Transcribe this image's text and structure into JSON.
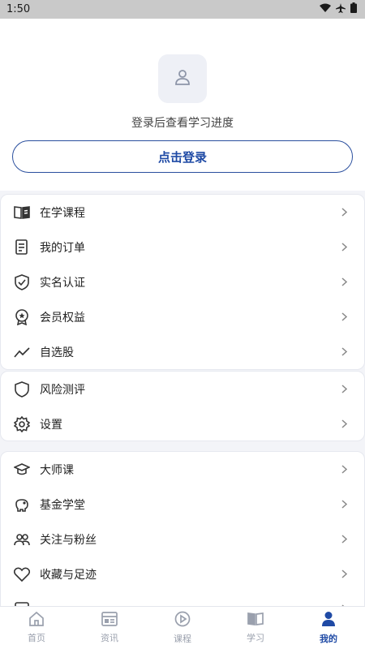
{
  "status_bar": {
    "time": "1:50"
  },
  "profile": {
    "login_hint": "登录后查看学习进度",
    "login_button": "点击登录"
  },
  "menu_group_1": [
    {
      "label": "在学课程",
      "icon": "book-icon"
    },
    {
      "label": "我的订单",
      "icon": "order-icon"
    },
    {
      "label": "实名认证",
      "icon": "shield-check-icon"
    },
    {
      "label": "会员权益",
      "icon": "medal-icon"
    },
    {
      "label": "自选股",
      "icon": "trend-icon"
    }
  ],
  "menu_group_2": [
    {
      "label": "风险测评",
      "icon": "shield-icon"
    },
    {
      "label": "设置",
      "icon": "gear-icon"
    }
  ],
  "menu_group_3": [
    {
      "label": "大师课",
      "icon": "graduation-cap-icon"
    },
    {
      "label": "基金学堂",
      "icon": "piggy-bank-icon"
    },
    {
      "label": "关注与粉丝",
      "icon": "users-icon"
    },
    {
      "label": "收藏与足迹",
      "icon": "heart-icon"
    },
    {
      "label": "",
      "icon": "test-icon"
    }
  ],
  "tabbar": {
    "tabs": [
      {
        "label": "首页",
        "icon": "home-icon"
      },
      {
        "label": "资讯",
        "icon": "news-icon"
      },
      {
        "label": "课程",
        "icon": "play-icon"
      },
      {
        "label": "学习",
        "icon": "book-open-icon"
      },
      {
        "label": "我的",
        "icon": "user-icon",
        "active": true
      }
    ]
  },
  "colors": {
    "accent": "#1f4aa5",
    "inactive": "#9aa0ad",
    "background": "#f3f4f8"
  }
}
